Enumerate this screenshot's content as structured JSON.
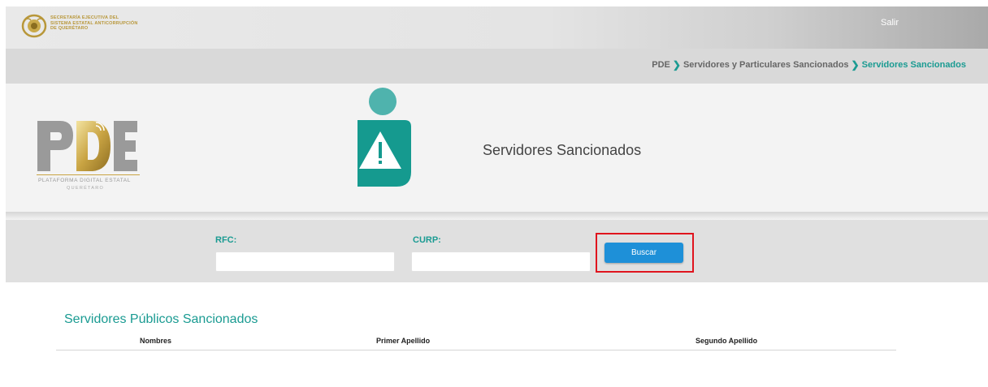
{
  "header": {
    "org_line1": "SECRETARÍA EJECUTIVA DEL",
    "org_line2": "SISTEMA ESTATAL ANTICORRUPCIÓN",
    "org_line3": "DE QUERÉTARO",
    "logout_label": "Salir"
  },
  "breadcrumb": {
    "items": [
      "PDE",
      "Servidores y Particulares Sancionados",
      "Servidores Sancionados"
    ]
  },
  "hero": {
    "logo_text": "PDE",
    "logo_sub1": "PLATAFORMA DIGITAL ESTATAL",
    "logo_sub2": "QUERÉTARO",
    "title": "Servidores Sancionados",
    "icon": "sanctioned-person-warning-icon"
  },
  "search": {
    "rfc_label": "RFC:",
    "rfc_value": "",
    "curp_label": "CURP:",
    "curp_value": "",
    "button_label": "Buscar"
  },
  "results": {
    "title": "Servidores Públicos Sancionados",
    "columns": [
      "Nombres",
      "Primer Apellido",
      "Segundo Apellido"
    ],
    "rows": []
  },
  "colors": {
    "accent": "#1a9b92",
    "button": "#1e90d8",
    "highlight": "#e0141e",
    "logo_gold": "#b8973a"
  }
}
